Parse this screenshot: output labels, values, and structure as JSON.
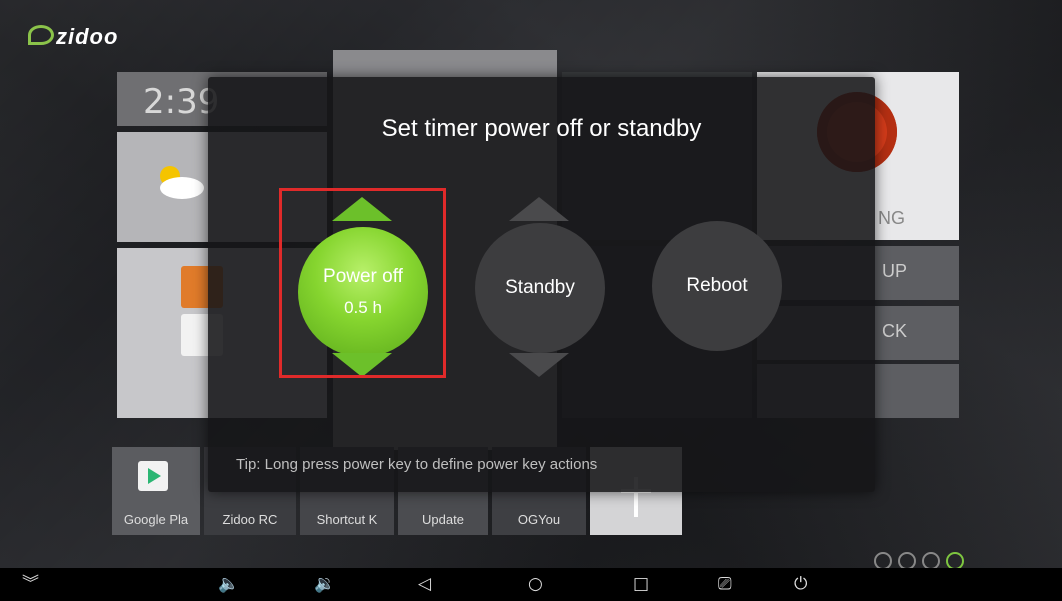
{
  "app": {
    "logo": "zidoo"
  },
  "launcher": {
    "clock_text": "2:39",
    "side_labels": [
      "NG",
      "UP",
      "CK"
    ]
  },
  "dock": [
    {
      "label": "Google Pla"
    },
    {
      "label": "Zidoo RC"
    },
    {
      "label": "Shortcut K"
    },
    {
      "label": "Update"
    },
    {
      "label": "OGYou"
    }
  ],
  "dialog": {
    "title": "Set timer power off or standby",
    "options": [
      {
        "label": "Power off",
        "value": "0.5  h",
        "selected": true
      },
      {
        "label": "Standby",
        "selected": false
      },
      {
        "label": "Reboot",
        "selected": false
      }
    ],
    "tip": "Tip: Long press power key to define power key actions"
  },
  "navbar": {
    "icons": [
      "collapse-icon",
      "volume-down-icon",
      "volume-up-icon",
      "back-icon",
      "home-icon",
      "recents-icon",
      "screenshot-icon",
      "power-icon"
    ]
  },
  "colors": {
    "accent_green": "#86d52f",
    "highlight_red": "#e02a2a"
  }
}
